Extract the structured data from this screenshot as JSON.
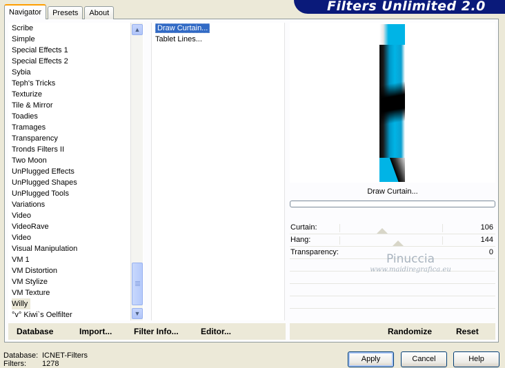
{
  "banner": {
    "title": "Filters Unlimited 2.0"
  },
  "tabs": [
    {
      "label": "Navigator",
      "active": true
    },
    {
      "label": "Presets",
      "active": false
    },
    {
      "label": "About",
      "active": false
    }
  ],
  "categories": [
    "Scribe",
    "Simple",
    "Special Effects 1",
    "Special Effects 2",
    "Sybia",
    "Teph's Tricks",
    "Texturize",
    "Tile & Mirror",
    "Toadies",
    "Tramages",
    "Transparency",
    "Tronds Filters II",
    "Two Moon",
    "UnPlugged Effects",
    "UnPlugged Shapes",
    "UnPlugged Tools",
    "Variations",
    "Video",
    "VideoRave",
    "Video",
    "Visual Manipulation",
    "VM 1",
    "VM Distortion",
    "VM Stylize",
    "VM Texture",
    "Willy",
    "°v° Kiwi`s Oelfilter"
  ],
  "selected_category": "Willy",
  "filters": [
    "Draw Curtain...",
    "Tablet Lines..."
  ],
  "selected_filter": "Draw Curtain...",
  "preview": {
    "filter_name": "Draw Curtain...",
    "progress": 0
  },
  "sliders": [
    {
      "label": "Curtain:",
      "value": "106",
      "fraction": 0.416
    },
    {
      "label": "Hang:",
      "value": "144",
      "fraction": 0.565
    },
    {
      "label": "Transparency:",
      "value": "0",
      "fraction": null
    }
  ],
  "watermark": {
    "line1": "Pinuccia",
    "line2": "www.maidiregrafica.eu"
  },
  "left_buttons": {
    "database": "Database",
    "import": "Import...",
    "filter_info": "Filter Info...",
    "editor": "Editor..."
  },
  "right_buttons": {
    "randomize": "Randomize",
    "reset": "Reset"
  },
  "status": {
    "database_label": "Database:",
    "database_value": "ICNET-Filters",
    "filters_label": "Filters:",
    "filters_value": "1278"
  },
  "dialog_buttons": {
    "apply": "Apply",
    "cancel": "Cancel",
    "help": "Help"
  },
  "colors": {
    "banner": "#0a1a7a",
    "selection": "#316ac5",
    "curtain_blue": "#00b4e6"
  }
}
